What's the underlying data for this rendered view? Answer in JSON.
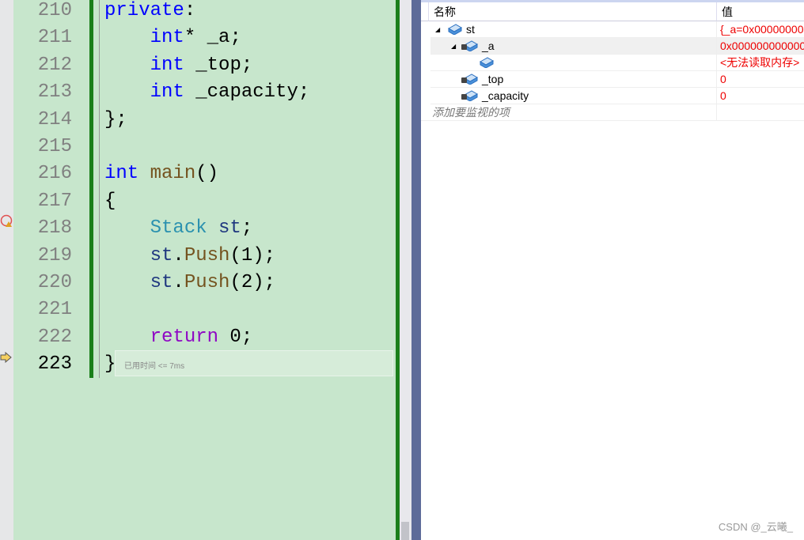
{
  "editor": {
    "lines": [
      {
        "num": "210",
        "parts": [
          [
            "kw",
            "private"
          ],
          [
            "",
            ":"
          ]
        ]
      },
      {
        "num": "211",
        "parts": [
          [
            "",
            "    "
          ],
          [
            "kw",
            "int"
          ],
          [
            "",
            "* _a;"
          ]
        ]
      },
      {
        "num": "212",
        "parts": [
          [
            "",
            "    "
          ],
          [
            "kw",
            "int"
          ],
          [
            "",
            " _top;"
          ]
        ]
      },
      {
        "num": "213",
        "parts": [
          [
            "",
            "    "
          ],
          [
            "kw",
            "int"
          ],
          [
            "",
            " _capacity;"
          ]
        ]
      },
      {
        "num": "214",
        "parts": [
          [
            "",
            "};"
          ]
        ]
      },
      {
        "num": "215",
        "parts": []
      },
      {
        "num": "216",
        "parts": [
          [
            "kw",
            "int"
          ],
          [
            "",
            " "
          ],
          [
            "fn",
            "main"
          ],
          [
            "",
            "()"
          ]
        ]
      },
      {
        "num": "217",
        "parts": [
          [
            "",
            "{"
          ]
        ]
      },
      {
        "num": "218",
        "parts": [
          [
            "",
            "    "
          ],
          [
            "ty",
            "Stack"
          ],
          [
            "",
            " "
          ],
          [
            "var",
            "st"
          ],
          [
            "",
            ";"
          ]
        ]
      },
      {
        "num": "219",
        "parts": [
          [
            "",
            "    "
          ],
          [
            "var",
            "st"
          ],
          [
            "",
            "."
          ],
          [
            "fn",
            "Push"
          ],
          [
            "",
            "(1);"
          ]
        ]
      },
      {
        "num": "220",
        "parts": [
          [
            "",
            "    "
          ],
          [
            "var",
            "st"
          ],
          [
            "",
            "."
          ],
          [
            "fn",
            "Push"
          ],
          [
            "",
            "(2);"
          ]
        ]
      },
      {
        "num": "221",
        "parts": []
      },
      {
        "num": "222",
        "parts": [
          [
            "",
            "    "
          ],
          [
            "ret",
            "return"
          ],
          [
            "",
            " 0;"
          ]
        ]
      },
      {
        "num": "223",
        "parts": [
          [
            "",
            "}"
          ]
        ]
      }
    ],
    "current_line": "223",
    "perf_hint": "已用时间 <= 7ms",
    "gutter_icons": {
      "218": "breakpoint-warning-icon",
      "223": "current-statement-arrow-icon"
    }
  },
  "watch": {
    "headers": {
      "name": "名称",
      "value": "值"
    },
    "rows": [
      {
        "name": "st",
        "value": "{_a=0x00000000",
        "indent": 0,
        "expand": true,
        "lock": false
      },
      {
        "name": "_a",
        "value": "0x000000000000",
        "indent": 1,
        "expand": true,
        "lock": true
      },
      {
        "name": "",
        "value": "<无法读取内存>",
        "indent": 2,
        "expand": false,
        "lock": false
      },
      {
        "name": "_top",
        "value": "0",
        "indent": 1,
        "expand": false,
        "lock": true
      },
      {
        "name": "_capacity",
        "value": "0",
        "indent": 1,
        "expand": false,
        "lock": true
      }
    ],
    "add_placeholder": "添加要监视的项"
  },
  "watermark": "CSDN @_云曦_",
  "colors": {
    "editor_bg": "#c7e6cc",
    "change_bar": "#1a7f1a",
    "error_value": "#e00000"
  }
}
